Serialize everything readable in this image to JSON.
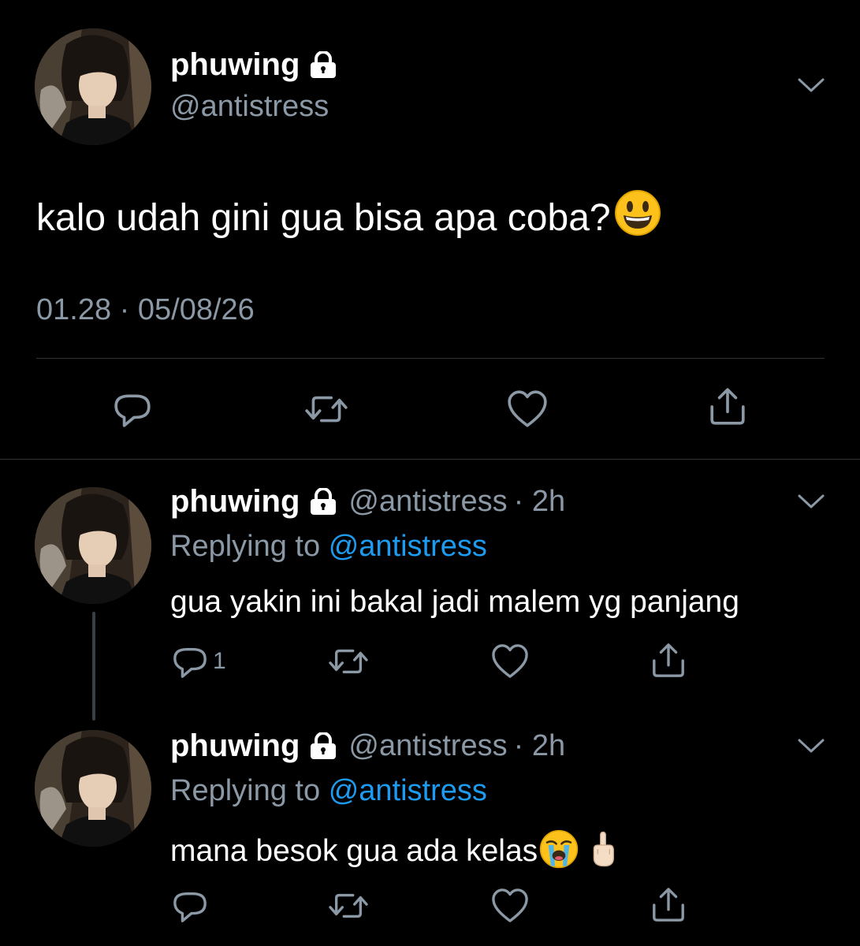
{
  "main_tweet": {
    "display_name": "phuwing",
    "handle": "@antistress",
    "text": "kalo udah gini gua bisa apa coba?",
    "text_emoji": "grinning-face-emoji",
    "timestamp": "01.28 · 05/08/26"
  },
  "replies": [
    {
      "display_name": "phuwing",
      "handle": "@antistress",
      "time": "· 2h",
      "replying_label": "Replying to",
      "replying_to": "@antistress",
      "text": "gua yakin ini bakal jadi malem yg panjang",
      "reply_count": "1"
    },
    {
      "display_name": "phuwing",
      "handle": "@antistress",
      "time": "· 2h",
      "replying_label": "Replying to",
      "replying_to": "@antistress",
      "text": "mana besok gua ada kelas",
      "text_emojis": [
        "loudly-crying-face-emoji",
        "middle-finger-emoji"
      ]
    }
  ],
  "colors": {
    "background": "#000000",
    "text": "#ffffff",
    "secondary": "#8b98a5",
    "link": "#1d9bf0",
    "divider": "#2f3336"
  },
  "icons": [
    "lock-icon",
    "chevron-down-icon",
    "reply-icon",
    "retweet-icon",
    "like-icon",
    "share-icon"
  ]
}
